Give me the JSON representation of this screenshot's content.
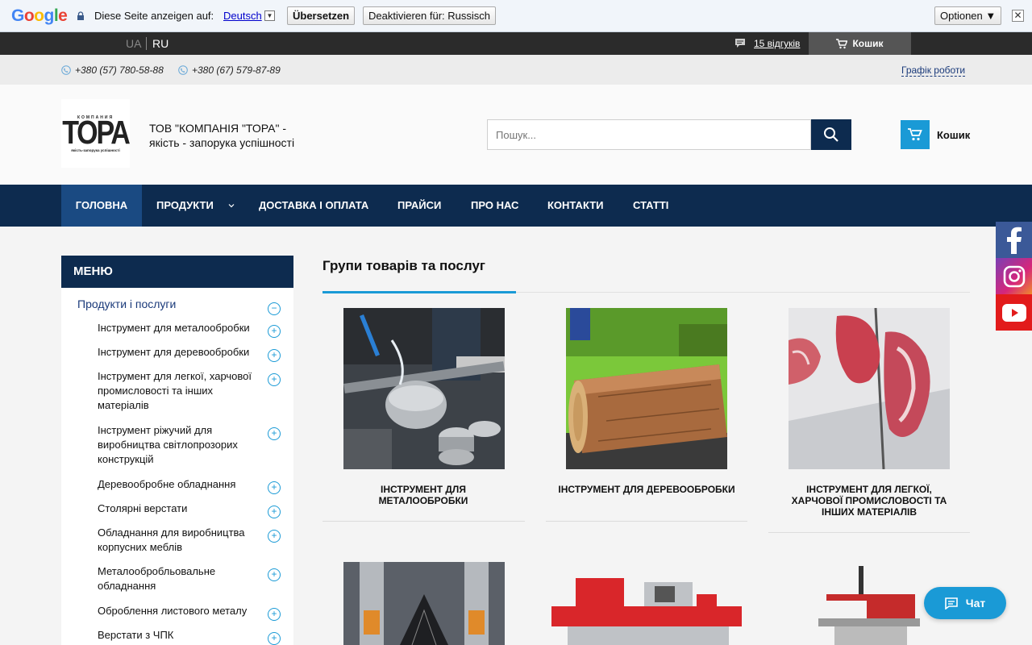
{
  "translate_bar": {
    "logo": "Google",
    "text": "Diese Seite anzeigen auf:",
    "language": "Deutsch",
    "translate_btn": "Übersetzen",
    "disable_btn": "Deaktivieren für: Russisch",
    "options_btn": "Optionen ▼",
    "close": "✕"
  },
  "topbar": {
    "lang_ua": "UA",
    "lang_ru": "RU",
    "reviews": "15 відгуків",
    "cart": "Кошик"
  },
  "phones": {
    "phone1": "+380 (57) 780-58-88",
    "phone2": "+380 (67) 579-87-89",
    "schedule": "Графік роботи"
  },
  "header": {
    "logo_top": "КОМПАНИЯ",
    "logo_main": "ТОРА",
    "logo_tag": "якість-запорука успішності",
    "slogan": "ТОВ \"КОМПАНІЯ \"ТОРА\" - якість - запорука успішності",
    "search_placeholder": "Пошук...",
    "cart": "Кошик"
  },
  "nav": {
    "home": "ГОЛОВНА",
    "products": "ПРОДУКТИ",
    "delivery": "ДОСТАВКА І ОПЛАТА",
    "prices": "ПРАЙСИ",
    "about": "ПРО НАС",
    "contacts": "КОНТАКТИ",
    "articles": "СТАТТІ"
  },
  "sidebar": {
    "header": "МЕНЮ",
    "root": "Продукти і послуги",
    "root_toggle": "−",
    "items": [
      "Інструмент для металообробки",
      "Інструмент для деревообробки",
      "Інструмент для легкої, харчової промисловості та інших матеріалів",
      "Інструмент ріжучий для виробництва світлопрозорих конструкцій",
      "Деревообробне обладнання",
      "Столярні верстати",
      "Обладнання для виробництва корпусних меблів",
      "Металообробльовальне обладнання",
      "Оброблення листового металу",
      "Верстати з ЧПК"
    ],
    "toggle": "+"
  },
  "content": {
    "title": "Групи товарів та послуг",
    "cards": [
      "ІНСТРУМЕНТ ДЛЯ МЕТАЛООБРОБКИ",
      "ІНСТРУМЕНТ ДЛЯ ДЕРЕВООБРОБКИ",
      "ІНСТРУМЕНТ ДЛЯ ЛЕГКОЇ, ХАРЧОВОЇ ПРОМИСЛОВОСТІ ТА ІНШИХ МАТЕРІАЛІВ"
    ]
  },
  "chat": "Чат",
  "colors": {
    "navy": "#0d2b4f",
    "accent": "#1a9ad6"
  }
}
